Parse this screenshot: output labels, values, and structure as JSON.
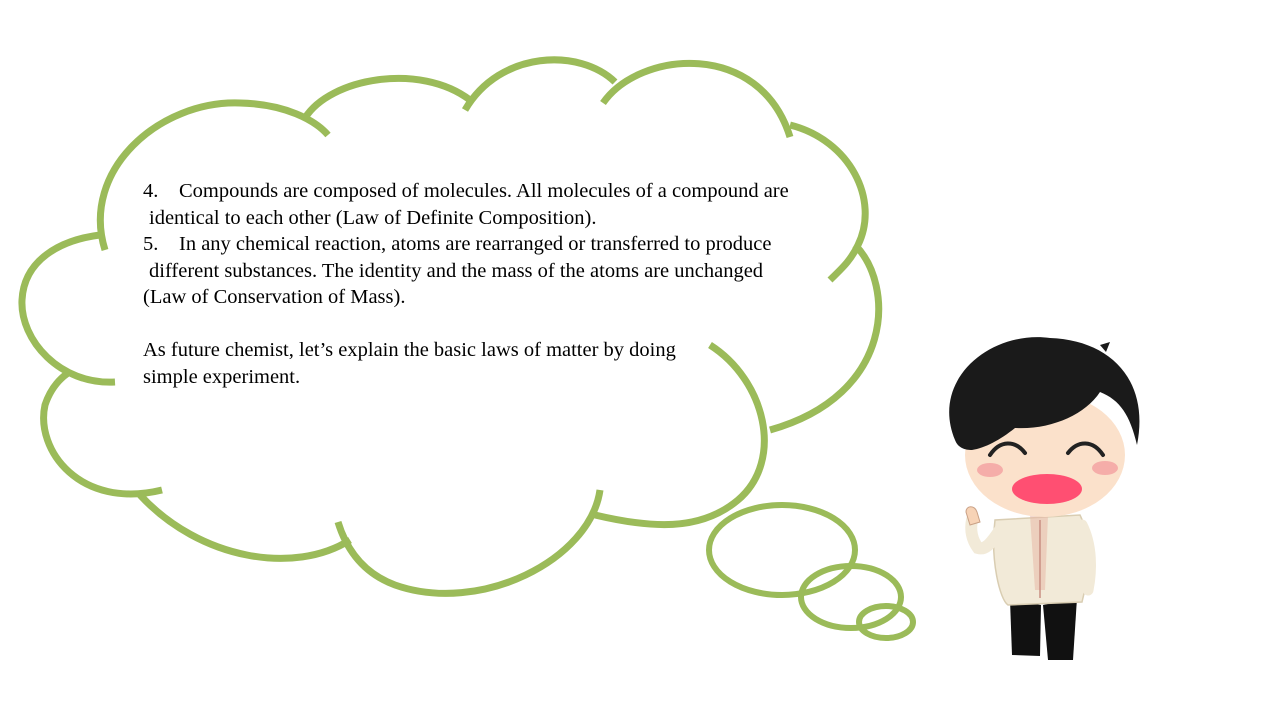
{
  "thought_bubble": {
    "items": [
      {
        "number": "4.",
        "line1": "Compounds are composed of molecules. All molecules of a compound are",
        "line2": "identical to each other (Law of Definite Composition)."
      },
      {
        "number": "5.",
        "line1": "In any chemical reaction, atoms are rearranged or transferred to produce",
        "line2": "different substances. The identity and the mass of the atoms are unchanged",
        "line3": "(Law of Conservation of Mass)."
      }
    ],
    "closing_line1": "As future chemist, let’s explain the basic laws of matter by doing",
    "closing_line2": "simple experiment."
  },
  "colors": {
    "cloud_outline": "#9bbb59",
    "background": "#ffffff",
    "text": "#000000"
  },
  "character": {
    "description_icon": "waving-boy-character"
  }
}
